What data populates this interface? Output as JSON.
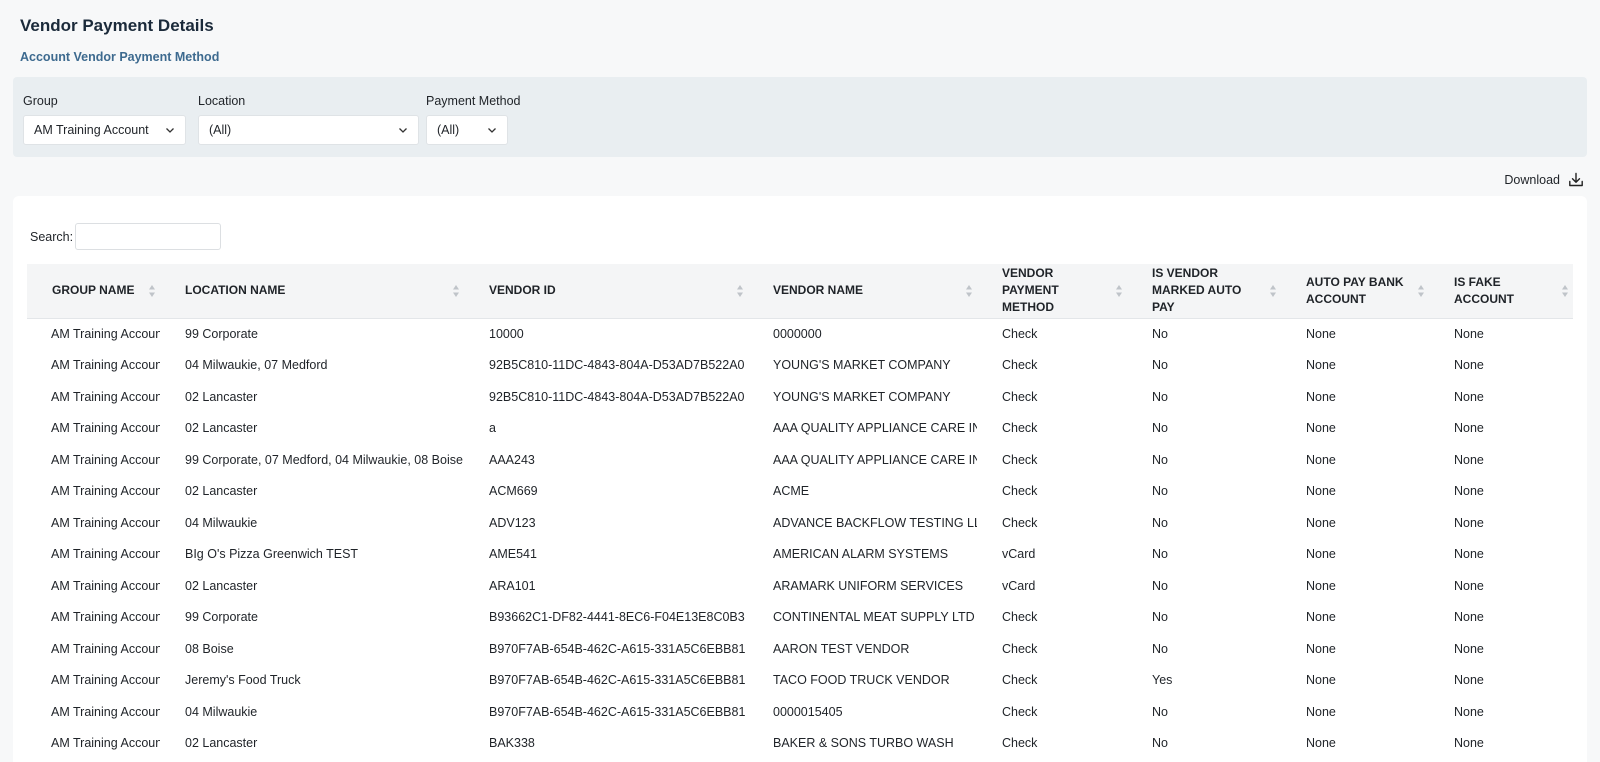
{
  "header": {
    "title": "Vendor Payment Details",
    "subtitle": "Account Vendor Payment Method"
  },
  "filters": {
    "group": {
      "label": "Group",
      "value": "AM Training Account"
    },
    "location": {
      "label": "Location",
      "value": "(All)"
    },
    "payment_method": {
      "label": "Payment Method",
      "value": "(All)"
    }
  },
  "download": {
    "label": "Download",
    "icon": "download-icon"
  },
  "search": {
    "label": "Search:",
    "value": "",
    "placeholder": ""
  },
  "table": {
    "columns": [
      "GROUP NAME",
      "LOCATION NAME",
      "VENDOR ID",
      "VENDOR NAME",
      "VENDOR PAYMENT METHOD",
      "IS VENDOR MARKED AUTO PAY",
      "AUTO PAY BANK ACCOUNT",
      "IS FAKE ACCOUNT"
    ],
    "rows": [
      [
        "AM Training Account",
        "99 Corporate",
        "10000",
        "0000000",
        "Check",
        "No",
        "None",
        "None"
      ],
      [
        "AM Training Account",
        "04 Milwaukie, 07 Medford",
        "92B5C810-11DC-4843-804A-D53AD7B522A0",
        "YOUNG'S MARKET COMPANY",
        "Check",
        "No",
        "None",
        "None"
      ],
      [
        "AM Training Account",
        "02 Lancaster",
        "92B5C810-11DC-4843-804A-D53AD7B522A0",
        "YOUNG'S MARKET COMPANY",
        "Check",
        "No",
        "None",
        "None"
      ],
      [
        "AM Training Account",
        "02 Lancaster",
        "a",
        "AAA QUALITY APPLIANCE CARE INC.",
        "Check",
        "No",
        "None",
        "None"
      ],
      [
        "AM Training Account",
        "99 Corporate, 07 Medford, 04 Milwaukie, 08 Boise",
        "AAA243",
        "AAA QUALITY APPLIANCE CARE INC.",
        "Check",
        "No",
        "None",
        "None"
      ],
      [
        "AM Training Account",
        "02 Lancaster",
        "ACM669",
        "ACME",
        "Check",
        "No",
        "None",
        "None"
      ],
      [
        "AM Training Account",
        "04 Milwaukie",
        "ADV123",
        "ADVANCE BACKFLOW TESTING LLC",
        "Check",
        "No",
        "None",
        "None"
      ],
      [
        "AM Training Account",
        "BIg O's Pizza Greenwich TEST",
        "AME541",
        "AMERICAN ALARM SYSTEMS",
        "vCard",
        "No",
        "None",
        "None"
      ],
      [
        "AM Training Account",
        "02 Lancaster",
        "ARA101",
        "ARAMARK UNIFORM SERVICES",
        "vCard",
        "No",
        "None",
        "None"
      ],
      [
        "AM Training Account",
        "99 Corporate",
        "B93662C1-DF82-4441-8EC6-F04E13E8C0B3",
        "CONTINENTAL MEAT SUPPLY LTD",
        "Check",
        "No",
        "None",
        "None"
      ],
      [
        "AM Training Account",
        "08 Boise",
        "B970F7AB-654B-462C-A615-331A5C6EBB81",
        "AARON TEST VENDOR",
        "Check",
        "No",
        "None",
        "None"
      ],
      [
        "AM Training Account",
        "Jeremy's Food Truck",
        "B970F7AB-654B-462C-A615-331A5C6EBB81",
        "TACO FOOD TRUCK VENDOR",
        "Check",
        "Yes",
        "None",
        "None"
      ],
      [
        "AM Training Account",
        "04 Milwaukie",
        "B970F7AB-654B-462C-A615-331A5C6EBB81",
        "0000015405",
        "Check",
        "No",
        "None",
        "None"
      ],
      [
        "AM Training Account",
        "02 Lancaster",
        "BAK338",
        "BAKER & SONS TURBO WASH",
        "Check",
        "No",
        "None",
        "None"
      ]
    ]
  }
}
